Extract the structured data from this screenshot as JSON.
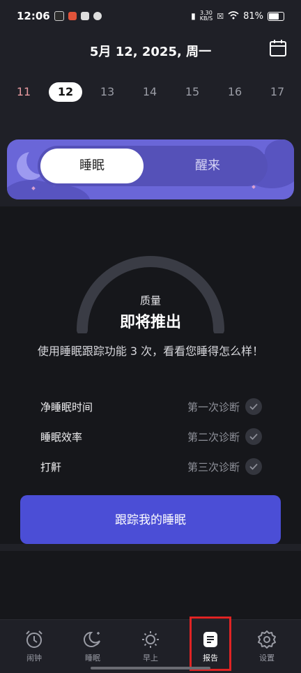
{
  "status_bar": {
    "time": "12:06",
    "net_speed_value": "3.30",
    "net_speed_unit": "KB/S",
    "battery": "81%"
  },
  "header": {
    "date_title": "5月 12, 2025, 周一",
    "days": [
      "11",
      "12",
      "13",
      "14",
      "15",
      "16",
      "17"
    ],
    "selected_day": "12"
  },
  "mode_toggle": {
    "sleep_label": "睡眠",
    "wake_label": "醒来"
  },
  "quality": {
    "label": "质量",
    "value": "即将推出"
  },
  "description": "使用睡眠跟踪功能 3 次，看看您睡得怎么样！",
  "metrics": [
    {
      "label": "净睡眠时间",
      "status": "第一次诊断"
    },
    {
      "label": "睡眠效率",
      "status": "第二次诊断"
    },
    {
      "label": "打鼾",
      "status": "第三次诊断"
    }
  ],
  "cta_label": "跟踪我的睡眠",
  "tabs": [
    {
      "label": "闹钟",
      "icon": "alarm-clock-icon"
    },
    {
      "label": "睡眠",
      "icon": "moon-icon"
    },
    {
      "label": "早上",
      "icon": "sun-icon"
    },
    {
      "label": "报告",
      "icon": "report-icon"
    },
    {
      "label": "设置",
      "icon": "gear-icon"
    }
  ],
  "active_tab": "报告",
  "colors": {
    "accent": "#4b4ed6",
    "banner": "#6a66d8",
    "highlight": "#e02424"
  }
}
